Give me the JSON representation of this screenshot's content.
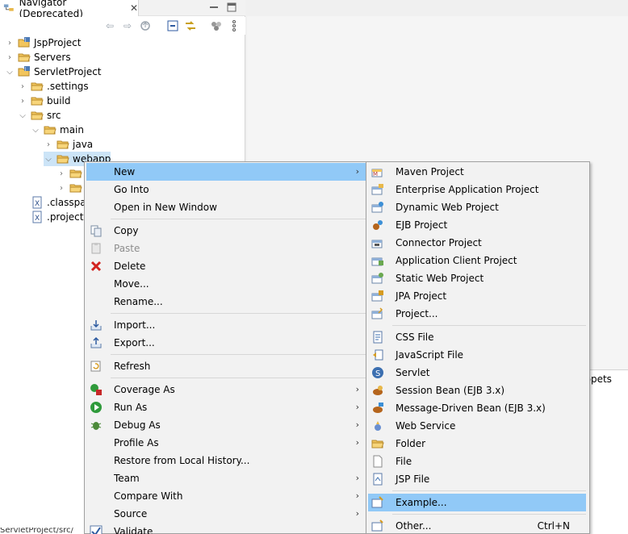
{
  "navigator": {
    "title": "Navigator (Deprecated)",
    "close_glyph": "✕",
    "tree": [
      {
        "label": "JspProject",
        "type": "project",
        "expanded": false
      },
      {
        "label": "Servers",
        "type": "folder",
        "expanded": false
      },
      {
        "label": "ServletProject",
        "type": "project",
        "expanded": true
      },
      {
        "label": ".settings",
        "type": "folder",
        "expanded": false
      },
      {
        "label": "build",
        "type": "folder",
        "expanded": false
      },
      {
        "label": "src",
        "type": "folder",
        "expanded": true
      },
      {
        "label": "main",
        "type": "folder",
        "expanded": true
      },
      {
        "label": "java",
        "type": "folder",
        "expanded": false
      },
      {
        "label": "webapp",
        "type": "folder",
        "expanded": true,
        "selected": true
      },
      {
        "label": "",
        "type": "folder",
        "expanded": false
      },
      {
        "label": "",
        "type": "folder",
        "expanded": false
      },
      {
        "label": ".classpat",
        "type": "file"
      },
      {
        "label": ".project",
        "type": "file"
      }
    ]
  },
  "snippets_tab": "ippets",
  "status_text": "ServletProject/src/",
  "context_menu": {
    "items": [
      {
        "label": "New",
        "submenu": true,
        "highlighted": true
      },
      {
        "label": "Go Into"
      },
      {
        "label": "Open in New Window"
      },
      {
        "label": "Copy",
        "icon": "copy-icon"
      },
      {
        "label": "Paste",
        "icon": "paste-icon",
        "disabled": true
      },
      {
        "label": "Delete",
        "icon": "delete-icon"
      },
      {
        "label": "Move..."
      },
      {
        "label": "Rename..."
      },
      {
        "label": "Import...",
        "icon": "import-icon"
      },
      {
        "label": "Export...",
        "icon": "export-icon"
      },
      {
        "label": "Refresh",
        "icon": "refresh-icon"
      },
      {
        "label": "Coverage As",
        "submenu": true,
        "icon": "coverage-icon"
      },
      {
        "label": "Run As",
        "submenu": true,
        "icon": "run-icon"
      },
      {
        "label": "Debug As",
        "submenu": true,
        "icon": "debug-icon"
      },
      {
        "label": "Profile As",
        "submenu": true
      },
      {
        "label": "Restore from Local History..."
      },
      {
        "label": "Team",
        "submenu": true
      },
      {
        "label": "Compare With",
        "submenu": true
      },
      {
        "label": "Source",
        "submenu": true
      },
      {
        "label": "Validate",
        "icon": "validate-icon"
      }
    ]
  },
  "new_submenu": {
    "items": [
      {
        "label": "Maven Project",
        "icon": "maven-project-icon"
      },
      {
        "label": "Enterprise Application Project",
        "icon": "enterprise-app-icon"
      },
      {
        "label": "Dynamic Web Project",
        "icon": "dynamic-web-icon"
      },
      {
        "label": "EJB Project",
        "icon": "ejb-project-icon"
      },
      {
        "label": "Connector Project",
        "icon": "connector-icon"
      },
      {
        "label": "Application Client Project",
        "icon": "app-client-icon"
      },
      {
        "label": "Static Web Project",
        "icon": "static-web-icon"
      },
      {
        "label": "JPA Project",
        "icon": "jpa-icon"
      },
      {
        "label": "Project...",
        "icon": "project-icon"
      },
      {
        "label": "CSS File",
        "icon": "css-file-icon"
      },
      {
        "label": "JavaScript File",
        "icon": "js-file-icon"
      },
      {
        "label": "Servlet",
        "icon": "servlet-icon"
      },
      {
        "label": "Session Bean (EJB 3.x)",
        "icon": "session-bean-icon"
      },
      {
        "label": "Message-Driven Bean (EJB 3.x)",
        "icon": "mdb-icon"
      },
      {
        "label": "Web Service",
        "icon": "web-service-icon"
      },
      {
        "label": "Folder",
        "icon": "folder-icon"
      },
      {
        "label": "File",
        "icon": "file-icon"
      },
      {
        "label": "JSP File",
        "icon": "jsp-file-icon"
      },
      {
        "label": "Example...",
        "icon": "example-icon",
        "highlighted": true
      },
      {
        "label": "Other...",
        "icon": "other-icon",
        "accelerator": "Ctrl+N"
      }
    ]
  },
  "colors": {
    "highlight": "#91c9f7",
    "selection": "#cce4f7",
    "folder": "#e8b84a"
  }
}
